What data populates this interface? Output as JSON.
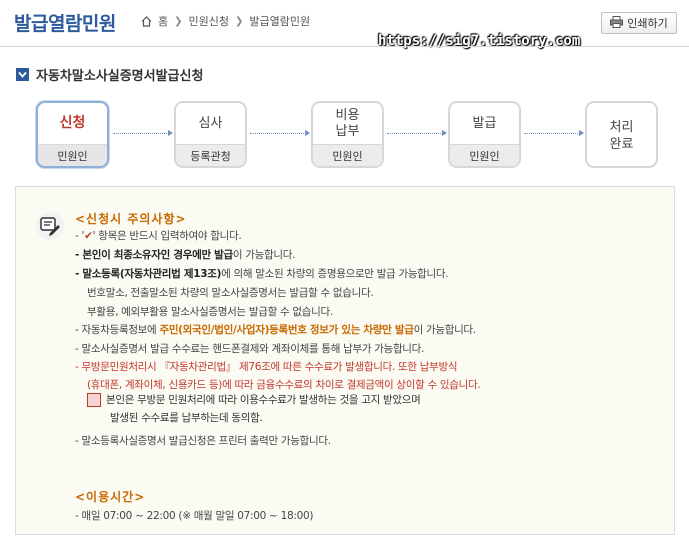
{
  "header": {
    "title": "발급열람민원",
    "breadcrumb": [
      "홈",
      "민원신청",
      "발급열람민원"
    ],
    "print_label": "인쇄하기",
    "watermark": "https://sig7.tistory.com"
  },
  "section": {
    "title": "자동차말소사실증명서발급신청"
  },
  "steps": [
    {
      "name": "신청",
      "role": "민원인",
      "active": true
    },
    {
      "name": "심사",
      "role": "등록관청"
    },
    {
      "name": "비용\n납부",
      "role": "민원인"
    },
    {
      "name": "발급",
      "role": "민원인"
    },
    {
      "name": "처리\n완료",
      "role": ""
    }
  ],
  "notice": {
    "heading": "<신청시 주의사항>",
    "lines": [
      {
        "prefix": "- '",
        "mark": "✔",
        "rest": "' 항목은 반드시 입력하여야 합니다."
      },
      {
        "bold": "- 본인이 최종소유자인 경우에만 발급",
        "rest": "이 가능합니다."
      },
      {
        "bold": "- 말소등록(자동차관리법 제13조)",
        "rest": "에 의해 말소된 차량의 증명용으로만 발급 가능합니다."
      },
      {
        "text": "번호말소, 전출말소된 차량의 말소사실증명서는 발급할 수 없습니다."
      },
      {
        "text": "부활용, 예외부활용 말소사실증명서는 발급할 수 없습니다."
      },
      {
        "pre": "- 자동차등록정보에 ",
        "orange": "주민(외국인/법인/사업자)등록번호 정보가 있는 차량만 발급",
        "rest": "이 가능합니다."
      },
      {
        "text": "- 말소사실증명서 발급 수수료는 핸드폰결제와 계좌이체를 통해 납부가 가능합니다."
      },
      {
        "text": "- 무방문민원처리시 『자동차관리법』 제76조에 따른 수수료가 발생합니다. 또한 납부방식"
      },
      {
        "text": "(휴대폰, 계좌이체, 신용카드 등)에 따라 금융수수료의 차이로 결제금액이 상이할 수 있습니다."
      },
      {
        "text": "- 말소등록사실증명서 발급신청은 프린터 출력만 가능합니다."
      }
    ],
    "consent": [
      "본인은 무방문 민원처리에 따라 이용수수료가 발생하는 것을 고지 받았으며",
      "발생된 수수료를 납부하는데 동의함."
    ],
    "hours_heading": "<이용시간>",
    "hours_text": "- 매일 07:00 ~ 22:00 (※ 매월 말일 07:00 ~ 18:00)"
  },
  "colors": {
    "accent": "#2d5a9c",
    "orange": "#c76a00",
    "red": "#c0392b"
  }
}
